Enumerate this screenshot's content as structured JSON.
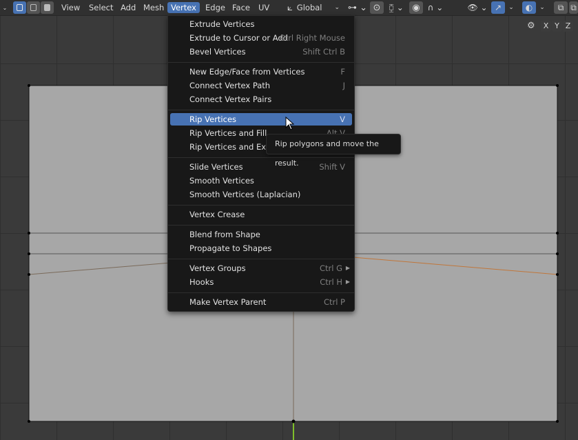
{
  "header": {
    "menus": [
      "View",
      "Select",
      "Add",
      "Mesh",
      "Vertex",
      "Edge",
      "Face",
      "UV"
    ],
    "active_menu": "Vertex",
    "orientation": "Global",
    "select_mode_icons": [
      "vertex-select-icon",
      "edge-select-icon",
      "face-select-icon"
    ]
  },
  "vertex_menu": {
    "items": [
      {
        "label": "Extrude Vertices",
        "shortcut": ""
      },
      {
        "label": "Extrude to Cursor or Add",
        "shortcut": "Ctrl Right Mouse"
      },
      {
        "label": "Bevel Vertices",
        "shortcut": "Shift Ctrl B"
      },
      {
        "label": "New Edge/Face from Vertices",
        "shortcut": "F"
      },
      {
        "label": "Connect Vertex Path",
        "shortcut": "J"
      },
      {
        "label": "Connect Vertex Pairs",
        "shortcut": ""
      },
      {
        "label": "Rip Vertices",
        "shortcut": "V"
      },
      {
        "label": "Rip Vertices and Fill",
        "shortcut": "Alt V"
      },
      {
        "label": "Rip Vertices and Extend",
        "shortcut": ""
      },
      {
        "label": "Slide Vertices",
        "shortcut": "Shift V"
      },
      {
        "label": "Smooth Vertices",
        "shortcut": ""
      },
      {
        "label": "Smooth Vertices (Laplacian)",
        "shortcut": ""
      },
      {
        "label": "Vertex Crease",
        "shortcut": ""
      },
      {
        "label": "Blend from Shape",
        "shortcut": ""
      },
      {
        "label": "Propagate to Shapes",
        "shortcut": ""
      },
      {
        "label": "Vertex Groups",
        "shortcut": "Ctrl G"
      },
      {
        "label": "Hooks",
        "shortcut": "Ctrl H"
      },
      {
        "label": "Make Vertex Parent",
        "shortcut": "Ctrl P"
      }
    ],
    "highlighted": "Rip Vertices"
  },
  "tooltip": {
    "text": "Rip polygons and move the result."
  },
  "axis_buttons": [
    "X",
    "Y",
    "Z"
  ],
  "colors": {
    "header_bg": "#303030",
    "accent": "#4772b3",
    "menu_bg": "#181818",
    "mesh_face": "#a7a7a7",
    "selected_edge": "#e07b2a",
    "y_axis": "#7fbf2a"
  }
}
